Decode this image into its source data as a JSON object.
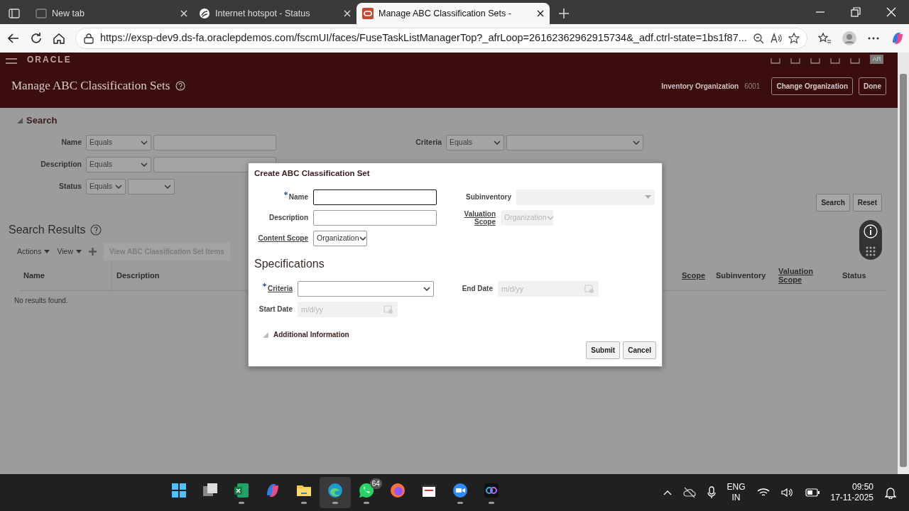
{
  "browser": {
    "tabs": [
      {
        "title": "New tab",
        "selected": false,
        "kind": "newtab"
      },
      {
        "title": "Internet hotspot - Status",
        "selected": false,
        "kind": "hotspot"
      },
      {
        "title": "Manage ABC Classification Sets -",
        "selected": true,
        "kind": "oracle"
      }
    ],
    "url": "https://exsp-dev9.ds-fa.oraclepdemos.com/fscmUI/faces/FuseTaskListManagerTop?_afrLoop=26162362962915734&_adf.ctrl-state=1bs1f87..."
  },
  "header": {
    "logo": "ORACLE",
    "user_initials": "AR",
    "page_title": "Manage ABC Classification Sets",
    "org_label": "Inventory Organization",
    "org_value": "6001",
    "buttons": [
      "Change Organization",
      "Done"
    ]
  },
  "search": {
    "title": "Search",
    "expanded": true,
    "fields": [
      {
        "label": "Name",
        "operator": "Equals",
        "kind": "text"
      },
      {
        "label": "Description",
        "operator": "Equals",
        "kind": "text"
      },
      {
        "label": "Status",
        "operator": "Equals",
        "kind": "select"
      }
    ],
    "right_fields": [
      {
        "label": "Criteria",
        "operator": "Equals",
        "kind": "select"
      }
    ],
    "buttons": [
      "Search",
      "Reset"
    ]
  },
  "results": {
    "title": "Search Results",
    "menus": [
      "Actions",
      "View"
    ],
    "action": "View ABC Classification Set Items",
    "action_disabled": true,
    "columns_left": [
      "Name",
      "Description"
    ],
    "columns_right": [
      "Scope",
      "Subinventory",
      "Valuation Scope",
      "Status"
    ],
    "empty": "No results found."
  },
  "dialog": {
    "title": "Create ABC Classification Set",
    "left_fields": [
      {
        "label": "Name",
        "kind": "text",
        "required": true,
        "focused": true,
        "disabled": false
      },
      {
        "label": "Description",
        "kind": "text",
        "required": false,
        "focused": false,
        "disabled": false
      },
      {
        "label": "Content Scope",
        "kind": "select",
        "required": false,
        "focused": false,
        "disabled": false,
        "value": "Organization"
      }
    ],
    "right_fields": [
      {
        "label": "Subinventory",
        "kind": "combo",
        "required": false,
        "focused": false,
        "disabled": true
      },
      {
        "label": "Valuation Scope",
        "kind": "select",
        "required": false,
        "focused": false,
        "disabled": true,
        "value": "Organization"
      }
    ],
    "section": "Specifications",
    "spec_left": [
      {
        "label": "Criteria",
        "kind": "select",
        "required": true,
        "focused": false,
        "disabled": false
      },
      {
        "label": "Start Date",
        "kind": "date",
        "required": false,
        "focused": false,
        "disabled": true,
        "placeholder": "m/d/yy"
      }
    ],
    "spec_right": [
      {
        "label": "End Date",
        "kind": "date",
        "required": false,
        "focused": false,
        "disabled": true,
        "placeholder": "m/d/yy"
      }
    ],
    "additional": {
      "label": "Additional Information",
      "expanded": false
    },
    "buttons": [
      "Submit",
      "Cancel"
    ]
  },
  "taskbar": {
    "apps": [
      {
        "kind": "start",
        "running": false,
        "selected": false
      },
      {
        "kind": "taskview",
        "running": false,
        "selected": false
      },
      {
        "kind": "excel",
        "running": true,
        "selected": false
      },
      {
        "kind": "copilot",
        "running": false,
        "selected": false
      },
      {
        "kind": "folder",
        "running": true,
        "selected": false
      },
      {
        "kind": "edge",
        "running": true,
        "selected": true
      },
      {
        "kind": "chat",
        "running": true,
        "selected": false,
        "badge": "64"
      },
      {
        "kind": "firefox",
        "running": false,
        "selected": false
      },
      {
        "kind": "media",
        "running": false,
        "selected": false
      },
      {
        "kind": "zoom",
        "running": true,
        "selected": false
      },
      {
        "kind": "app",
        "running": true,
        "selected": false
      }
    ],
    "language": "ENG",
    "region": "IN",
    "time": "09:50",
    "date": "17-11-2025"
  }
}
